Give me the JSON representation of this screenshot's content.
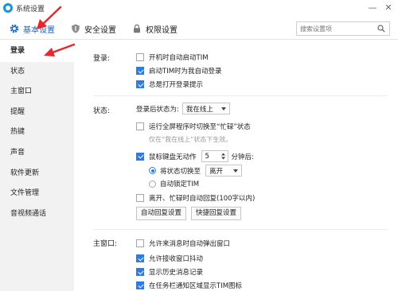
{
  "window": {
    "title": "系统设置",
    "minimize": "—",
    "close": "✕"
  },
  "toolbar": {
    "tabs": [
      {
        "label": "基本设置",
        "icon": "gear-icon"
      },
      {
        "label": "安全设置",
        "icon": "shield-icon"
      },
      {
        "label": "权限设置",
        "icon": "lock-icon"
      }
    ],
    "search_placeholder": "搜索设置项"
  },
  "sidebar": {
    "items": [
      {
        "label": "登录"
      },
      {
        "label": "状态"
      },
      {
        "label": "主窗口"
      },
      {
        "label": "提醒"
      },
      {
        "label": "热键"
      },
      {
        "label": "声音"
      },
      {
        "label": "软件更新"
      },
      {
        "label": "文件管理"
      },
      {
        "label": "音视频通话"
      }
    ],
    "active": "登录"
  },
  "login": {
    "label": "登录:",
    "options": [
      {
        "text": "开机时自动启动TIM",
        "checked": false
      },
      {
        "text": "启动TIM时为我自动登录",
        "checked": true
      },
      {
        "text": "总是打开登录提示",
        "checked": true
      }
    ]
  },
  "status": {
    "label": "状态:",
    "after_login_label": "登录后状态为:",
    "after_login_value": "我在线上",
    "fullscreen_text": "运行全屏程序时切换至“忙碌”状态",
    "fullscreen_checked": false,
    "fullscreen_hint": "仅在“我在线上”状态下生效。",
    "idle_prefix": "鼠标键盘无动作",
    "idle_checked": true,
    "idle_minutes": "5",
    "idle_suffix": "分钟后:",
    "switch_label": "将状态切换至",
    "switch_value": "离开",
    "switch_selected": true,
    "lock_label": "自动锁定TIM",
    "lock_selected": false,
    "auto_reply_text": "离开、忙碌时自动回复(100字以内)",
    "auto_reply_checked": false,
    "btn_auto_reply": "自动回复设置",
    "btn_quick_reply": "快捷回复设置"
  },
  "main_window": {
    "label": "主窗口:",
    "options": [
      {
        "text": "允许来消息时自动弹出窗口",
        "checked": false
      },
      {
        "text": "允许接收窗口抖动",
        "checked": true
      },
      {
        "text": "显示历史消息记录",
        "checked": true
      },
      {
        "text": "在任务栏通知区域显示TIM图标",
        "checked": true
      }
    ]
  },
  "colors": {
    "accent": "#2b7ce9",
    "annotation": "#e8262c"
  }
}
